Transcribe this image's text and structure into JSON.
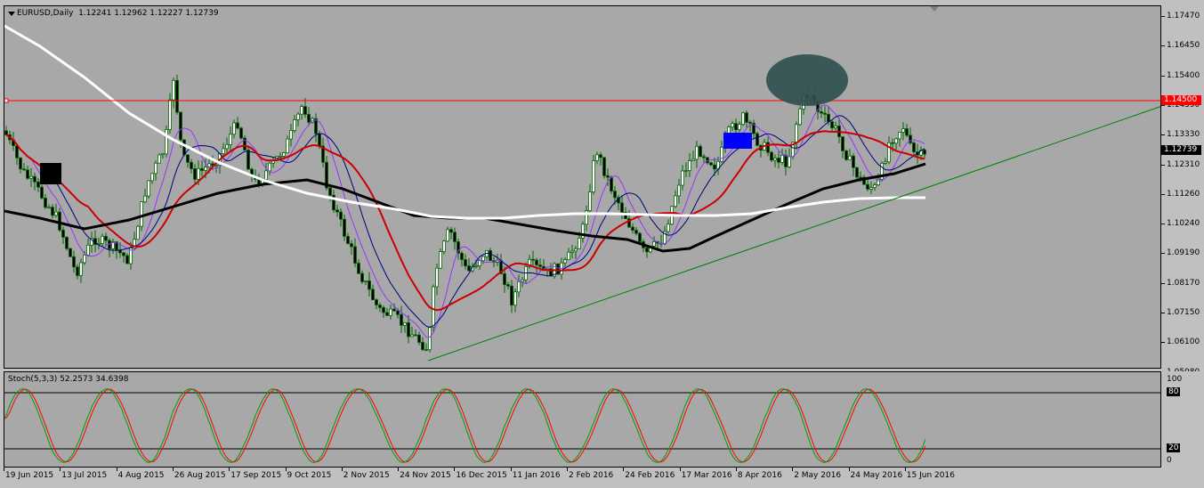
{
  "chart": {
    "symbol_label": "EURUSD,Daily",
    "ohlc_label": "1.12241 1.12962 1.12227 1.12739",
    "price_labels": [
      "1.17470",
      "1.16450",
      "1.15400",
      "1.14390",
      "1.13330",
      "1.12310",
      "1.11260",
      "1.10240",
      "1.09190",
      "1.08170",
      "1.07150",
      "1.06100",
      "1.05080"
    ],
    "hline_price_label": "1.14500",
    "last_price_label": "1.12739",
    "colors": {
      "background": "#a8a8a8",
      "candle": "#006400",
      "resistance_line": "#ff0000",
      "trendline": "#008000",
      "ma_black": "#000000",
      "ma_white": "#ffffff",
      "ma_red": "#cc0000",
      "ma_purple": "#9933ff",
      "ma_navy": "#000080",
      "marker_blue": "#0000ff",
      "marker_black": "#000000",
      "ellipse": "#2f4f4f"
    }
  },
  "stochastic": {
    "label": "Stoch(5,3,3) 52.2573 34.6398",
    "levels": [
      "100",
      "80",
      "20",
      "0"
    ],
    "colors": {
      "main": "#00a000",
      "signal": "#ff0000"
    }
  },
  "time_labels": [
    "19 Jun 2015",
    "13 Jul 2015",
    "4 Aug 2015",
    "26 Aug 2015",
    "17 Sep 2015",
    "9 Oct 2015",
    "2 Nov 2015",
    "24 Nov 2015",
    "16 Dec 2015",
    "11 Jan 2016",
    "2 Feb 2016",
    "24 Feb 2016",
    "17 Mar 2016",
    "8 Apr 2016",
    "2 May 2016",
    "24 May 2016",
    "15 Jun 2016"
  ]
}
